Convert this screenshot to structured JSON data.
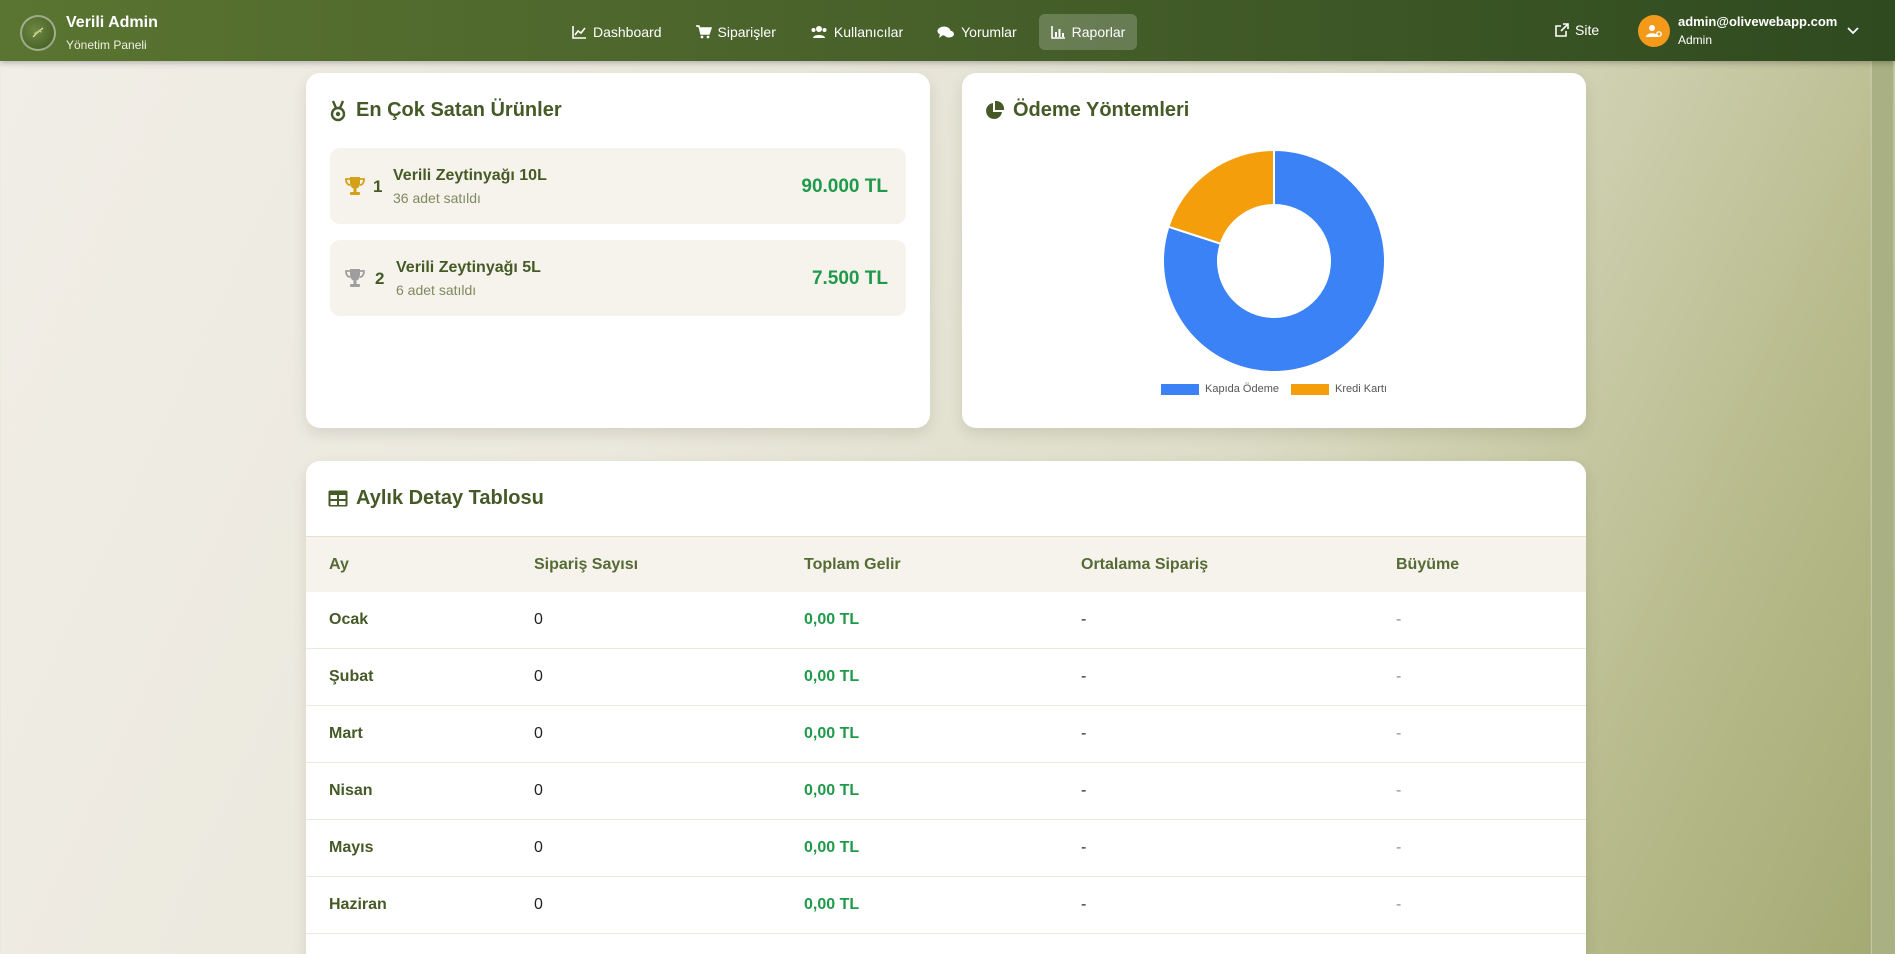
{
  "brand": {
    "title": "Verili Admin",
    "subtitle": "Yönetim Paneli"
  },
  "nav": {
    "items": [
      {
        "label": "Dashboard",
        "icon": "chart-line-icon"
      },
      {
        "label": "Siparişler",
        "icon": "cart-icon"
      },
      {
        "label": "Kullanıcılar",
        "icon": "users-icon"
      },
      {
        "label": "Yorumlar",
        "icon": "comments-icon"
      },
      {
        "label": "Raporlar",
        "icon": "chart-bar-icon",
        "active": true
      }
    ],
    "site_label": "Site"
  },
  "user": {
    "email": "admin@olivewebapp.com",
    "role": "Admin"
  },
  "top_products": {
    "title": "En Çok Satan Ürünler",
    "items": [
      {
        "rank": "1",
        "name": "Verili Zeytinyağı 10L",
        "sold": "36 adet satıldı",
        "revenue": "90.000 TL",
        "trophy_color": "#d4a017"
      },
      {
        "rank": "2",
        "name": "Verili Zeytinyağı 5L",
        "sold": "6 adet satıldı",
        "revenue": "7.500 TL",
        "trophy_color": "#9e9e9e"
      }
    ]
  },
  "payment_methods": {
    "title": "Ödeme Yöntemleri",
    "chart_data": {
      "type": "pie",
      "categories": [
        "Kapıda Ödeme",
        "Kredi Kartı"
      ],
      "values": [
        80,
        20
      ],
      "colors": [
        "#3b82f6",
        "#f59e0b"
      ],
      "legend": "bottom"
    }
  },
  "monthly_table": {
    "title": "Aylık Detay Tablosu",
    "columns": [
      "Ay",
      "Sipariş Sayısı",
      "Toplam Gelir",
      "Ortalama Sipariş",
      "Büyüme"
    ],
    "rows": [
      [
        "Ocak",
        "0",
        "0,00 TL",
        "-",
        "-"
      ],
      [
        "Şubat",
        "0",
        "0,00 TL",
        "-",
        "-"
      ],
      [
        "Mart",
        "0",
        "0,00 TL",
        "-",
        "-"
      ],
      [
        "Nisan",
        "0",
        "0,00 TL",
        "-",
        "-"
      ],
      [
        "Mayıs",
        "0",
        "0,00 TL",
        "-",
        "-"
      ],
      [
        "Haziran",
        "0",
        "0,00 TL",
        "-",
        "-"
      ]
    ]
  },
  "colors": {
    "accent": "#465a27",
    "success": "#1f9a4a",
    "avatar": "#f39a1b"
  }
}
